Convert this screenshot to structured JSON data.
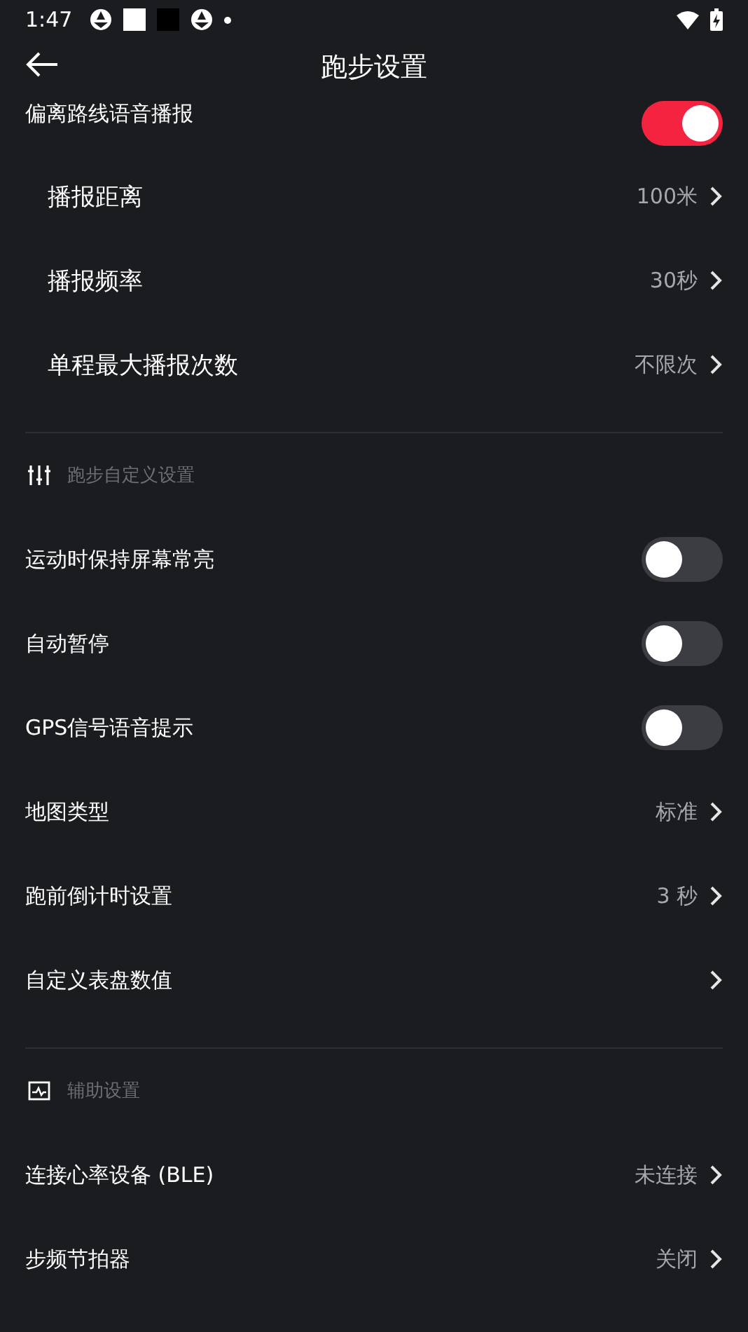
{
  "status_bar": {
    "time": "1:47"
  },
  "header": {
    "title": "跑步设置"
  },
  "sections": [
    {
      "rows": [
        {
          "kind": "toggle",
          "label": "偏离路线语音播报",
          "on": true
        },
        {
          "kind": "sublink",
          "label": "播报距离",
          "value": "100米"
        },
        {
          "kind": "sublink",
          "label": "播报频率",
          "value": "30秒"
        },
        {
          "kind": "sublink",
          "label": "单程最大播报次数",
          "value": "不限次"
        }
      ]
    },
    {
      "title": "跑步自定义设置",
      "rows": [
        {
          "kind": "toggle",
          "label": "运动时保持屏幕常亮",
          "on": false
        },
        {
          "kind": "toggle",
          "label": "自动暂停",
          "on": false
        },
        {
          "kind": "toggle",
          "label": "GPS信号语音提示",
          "on": false
        },
        {
          "kind": "link",
          "label": "地图类型",
          "value": "标准"
        },
        {
          "kind": "link",
          "label": "跑前倒计时设置",
          "value": "3 秒"
        },
        {
          "kind": "link",
          "label": "自定义表盘数值"
        }
      ]
    },
    {
      "title": "辅助设置",
      "rows": [
        {
          "kind": "link",
          "label": "连接心率设备 (BLE)",
          "value": "未连接"
        },
        {
          "kind": "link",
          "label": "步频节拍器",
          "value": "关闭"
        }
      ]
    }
  ]
}
